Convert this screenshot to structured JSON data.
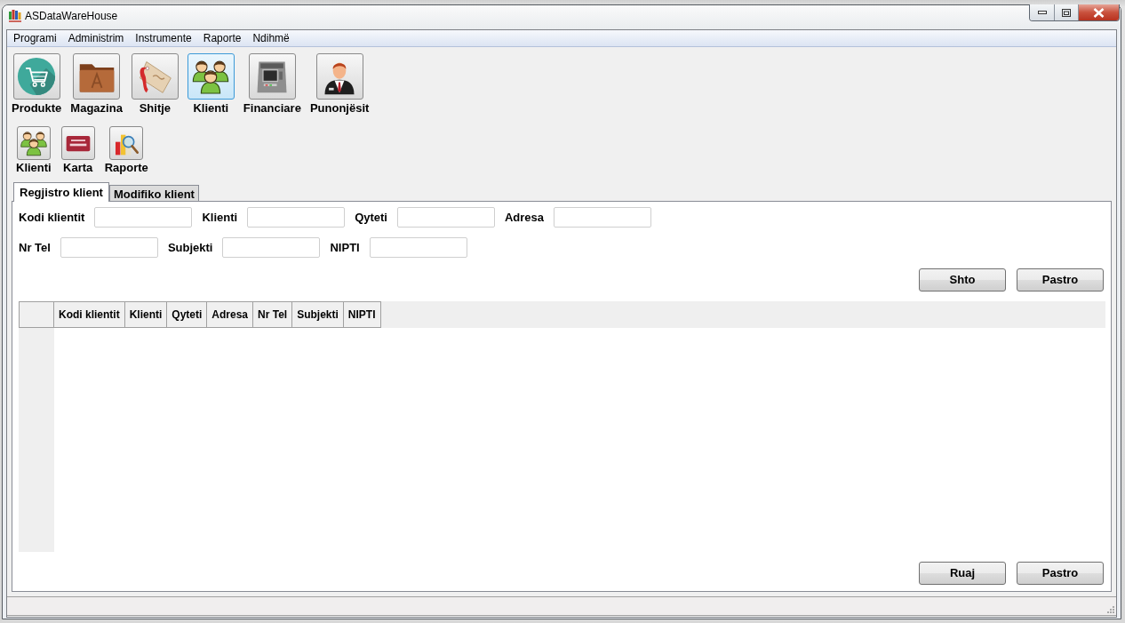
{
  "window": {
    "title": "ASDataWareHouse"
  },
  "menu": [
    "Programi",
    "Administrim",
    "Instrumente",
    "Raporte",
    "Ndihmë"
  ],
  "modules": [
    {
      "label": "Produkte",
      "kind": "cart",
      "selected": false
    },
    {
      "label": "Magazina",
      "kind": "folder",
      "selected": false
    },
    {
      "label": "Shitje",
      "kind": "tag",
      "selected": false
    },
    {
      "label": "Klienti",
      "kind": "people",
      "selected": true
    },
    {
      "label": "Financiare",
      "kind": "atm",
      "selected": false
    },
    {
      "label": "Punonjësit",
      "kind": "employee",
      "selected": false
    }
  ],
  "submodules": [
    {
      "label": "Klienti",
      "kind": "people"
    },
    {
      "label": "Karta",
      "kind": "card"
    },
    {
      "label": "Raporte",
      "kind": "report"
    }
  ],
  "tabs": [
    {
      "label": "Regjistro klient",
      "selected": true
    },
    {
      "label": "Modifiko klient",
      "selected": false
    }
  ],
  "form": {
    "rows": [
      [
        {
          "label": "Kodi klientit"
        },
        {
          "label": "Klienti"
        },
        {
          "label": "Qyteti"
        },
        {
          "label": "Adresa"
        }
      ],
      [
        {
          "label": "Nr Tel"
        },
        {
          "label": "Subjekti"
        },
        {
          "label": "NIPTI"
        }
      ]
    ],
    "buttons": [
      "Shto",
      "Pastro"
    ]
  },
  "table": {
    "columns": [
      "Kodi klientit",
      "Klienti",
      "Qyteti",
      "Adresa",
      "Nr Tel",
      "Subjekti",
      "NIPTI"
    ]
  },
  "footer_buttons": [
    "Ruaj",
    "Pastro"
  ]
}
